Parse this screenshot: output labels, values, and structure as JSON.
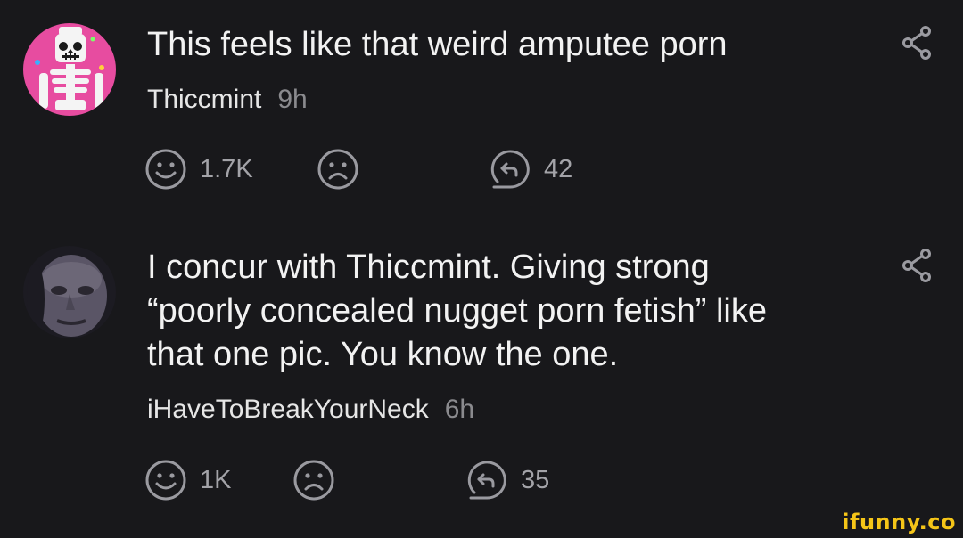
{
  "comments": [
    {
      "text": "This feels like that weird amputee porn",
      "username": "Thiccmint",
      "time": "9h",
      "likes": "1.7K",
      "replies": "42",
      "avatar": "skeleton-avatar"
    },
    {
      "text": "I concur with Thiccmint. Giving strong\n“poorly concealed nugget porn fetish” like\nthat one pic. You know the one.",
      "username": "iHaveToBreakYourNeck",
      "time": "6h",
      "likes": "1K",
      "replies": "35",
      "avatar": "face-avatar"
    }
  ],
  "icons": {
    "like": "smile-icon",
    "dislike": "frown-icon",
    "reply": "reply-icon",
    "share": "share-icon"
  },
  "watermark": "ifunny.co",
  "colors": {
    "background": "#18181b",
    "text": "#f2f2f2",
    "muted": "#8a8a8e",
    "icon": "#9a9aa0",
    "avatar1_bg": "#e74ca0",
    "watermark": "#f5c518"
  }
}
